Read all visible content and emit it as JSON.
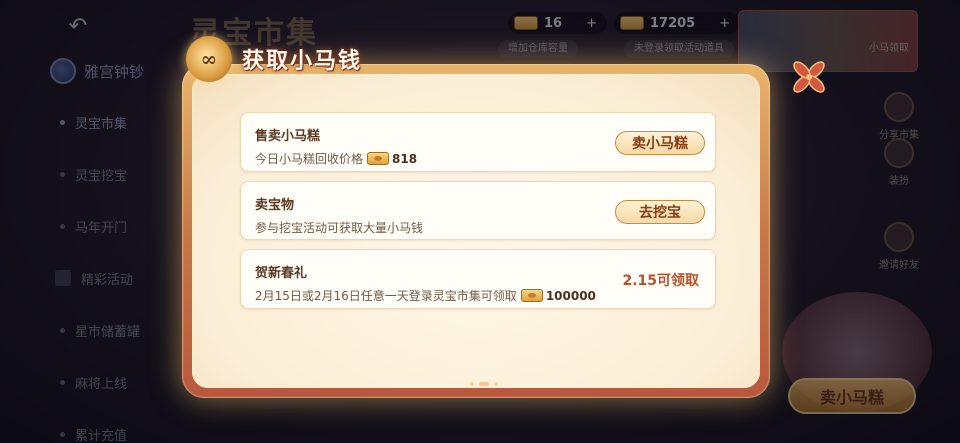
{
  "background": {
    "title": "灵宝市集",
    "brand": "雅宫钟钞",
    "sidebar": [
      {
        "label": "灵宝市集",
        "active": true
      },
      {
        "label": "灵宝挖宝",
        "active": false
      },
      {
        "label": "马年开门",
        "active": false
      },
      {
        "label": "精彩活动",
        "active": false
      },
      {
        "label": "星市储蓄罐",
        "active": false
      },
      {
        "label": "麻将上线",
        "active": false
      },
      {
        "label": "累计充值",
        "active": false
      }
    ],
    "resources": [
      {
        "icon": "coin-icon",
        "value": "16"
      },
      {
        "icon": "ticket-icon",
        "value": "17205"
      }
    ],
    "tags": [
      "增加仓库容量",
      "未登录领取活动道具"
    ],
    "hero_card_label": "小马领取",
    "right_icons": [
      {
        "icon": "share-market-icon",
        "label": "分享市集"
      },
      {
        "icon": "wardrobe-icon",
        "label": "装扮"
      },
      {
        "icon": "invite-friend-icon",
        "label": "邀请好友"
      }
    ],
    "mascot_button": "卖小马糕"
  },
  "dialog": {
    "title": "获取小马钱",
    "tasks": [
      {
        "title": "售卖小马糕",
        "desc": "今日小马糕回收价格",
        "amount": "818",
        "action": "卖小马糕",
        "status": ""
      },
      {
        "title": "卖宝物",
        "desc": "参与挖宝活动可获取大量小马钱",
        "amount": "",
        "action": "去挖宝",
        "status": ""
      },
      {
        "title": "贺新春礼",
        "desc": "2月15日或2月16日任意一天登录灵宝市集可领取",
        "amount": "100000",
        "action": "",
        "status": "2.15可领取"
      }
    ]
  },
  "colors": {
    "dialog_frame": "#c7784a",
    "dialog_body": "#fbeed6",
    "button_text": "#8a3d14",
    "status_text": "#b8522a"
  }
}
